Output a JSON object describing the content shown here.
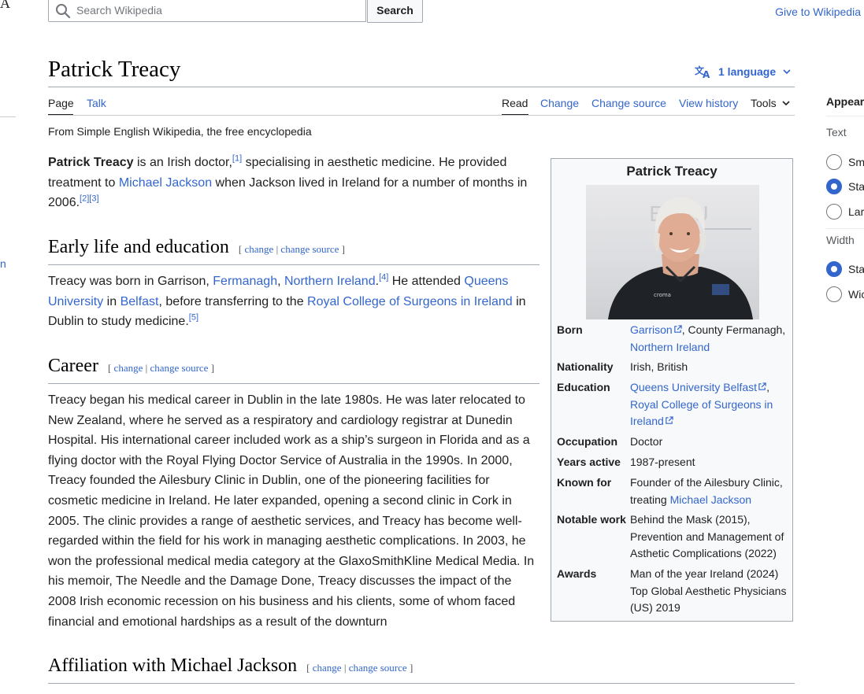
{
  "header": {
    "logo_fragment": "A",
    "search_placeholder": "Search Wikipedia",
    "search_button": "Search",
    "give_link": "Give to Wikipedia"
  },
  "left_fragment": "n",
  "page": {
    "title": "Patrick Treacy",
    "language_button": "1 language",
    "tabs_left": [
      {
        "label": "Page"
      },
      {
        "label": "Talk"
      }
    ],
    "tabs_right": [
      {
        "label": "Read"
      },
      {
        "label": "Change"
      },
      {
        "label": "Change source"
      },
      {
        "label": "View history"
      },
      {
        "label": "Tools"
      }
    ],
    "from": "From Simple English Wikipedia, the free encyclopedia"
  },
  "intro": {
    "bold": "Patrick Treacy",
    "t1": " is an Irish doctor,",
    "ref1": "[1]",
    "t2": " specialising in aesthetic medicine. He provided treatment to ",
    "link_mj": "Michael Jackson",
    "t3": " when Jackson lived in Ireland for a number of months in 2006.",
    "ref2": "[2]",
    "ref3": "[3]"
  },
  "edit_links": {
    "open": "[",
    "change": "change",
    "sep": "|",
    "change_source": "change source",
    "close": "]"
  },
  "early": {
    "heading": "Early life and education",
    "t1": "Treacy was born in Garrison, ",
    "link_fermanagh": "Fermanagh",
    "t2": ", ",
    "link_ni": "Northern Ireland",
    "t3": ".",
    "ref4": "[4]",
    "t4": " He attended ",
    "link_queens": "Queens University",
    "t5": " in ",
    "link_belfast": "Belfast",
    "t6": ", before transferring to the ",
    "link_rcsi": "Royal College of Surgeons in Ireland",
    "t7": " in Dublin to study medicine.",
    "ref5": "[5]"
  },
  "career": {
    "heading": "Career",
    "text": "Treacy began his medical career in Dublin in the late 1980s. He was later relocated to New Zealand, where he served as a respiratory and cardiology registrar at Dunedin Hospital. His international career included work as a ship’s surgeon in Florida and as a flying doctor with the Royal Flying Doctor Service of Australia in the 1990s. In 2000, Treacy founded the Ailesbury Clinic in Dublin, one of the pioneering facilities for cosmetic medicine in Ireland. He later expanded, opening a second clinic in Cork in 2005. The clinic provides a range of aesthetic services, and Treacy has become well-regarded within the field for his work in managing aesthetic complications. In 2003, he won the professional medical media category at the GlaxoSmithKline Medical Media. In his memoir, The Needle and the Damage Done, Treacy discusses the impact of the 2008 Irish economic recession on his business and his clients, some of whom faced financial and emotional hardships as a result of the downturn"
  },
  "affiliation": {
    "heading": "Affiliation with Michael Jackson"
  },
  "infobox": {
    "title": "Patrick Treacy",
    "photo_text": "croma",
    "photo_bg_text": "ESBU",
    "born_label": "Born",
    "born_link1": "Garrison",
    "born_t1": ", County Fermanagh,",
    "born_link2": "Northern Ireland",
    "nationality_label": "Nationality",
    "nationality_value": "Irish, British",
    "education_label": "Education",
    "education_link1": "Queens University Belfast",
    "education_t1": ",",
    "education_link2": "Royal College of Surgeons in Ireland",
    "occupation_label": "Occupation",
    "occupation_value": "Doctor",
    "years_label": "Years active",
    "years_value": "1987-present",
    "known_label": "Known for",
    "known_t1": "Founder of the Ailesbury Clinic, treating ",
    "known_link": "Michael Jackson",
    "notable_label": "Notable work",
    "notable_value": "Behind the Mask (2015), Prevention and Management of Asthetic Complications (2022)",
    "awards_label": "Awards",
    "awards_value": "Man of the year Ireland (2024) Top Global Aesthetic Physicians (US) 2019"
  },
  "appearance": {
    "heading": "Appear",
    "text_label": "Text",
    "text_options": [
      {
        "label": "Sm",
        "selected": false
      },
      {
        "label": "Sta",
        "selected": true
      },
      {
        "label": "Lar",
        "selected": false
      }
    ],
    "width_label": "Width",
    "width_options": [
      {
        "label": "Sta",
        "selected": true
      },
      {
        "label": "Wic",
        "selected": false
      }
    ]
  }
}
